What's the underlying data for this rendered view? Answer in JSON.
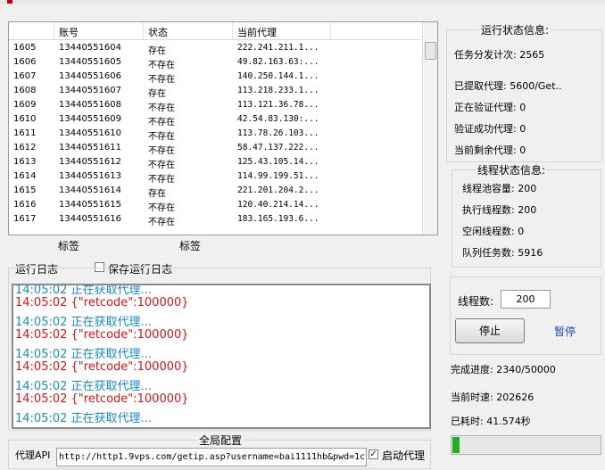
{
  "table": {
    "headers": [
      "",
      "账号",
      "状态",
      "当前代理"
    ],
    "rows": [
      [
        "1605",
        "13440551604",
        "存在",
        "222.241.211.1..."
      ],
      [
        "1606",
        "13440551605",
        "不存在",
        "49.82.163.63:..."
      ],
      [
        "1607",
        "13440551606",
        "不存在",
        "140.250.144.1..."
      ],
      [
        "1608",
        "13440551607",
        "存在",
        "113.218.233.1..."
      ],
      [
        "1609",
        "13440551608",
        "不存在",
        "113.121.36.78..."
      ],
      [
        "1610",
        "13440551609",
        "不存在",
        "42.54.83.130:..."
      ],
      [
        "1611",
        "13440551610",
        "不存在",
        "113.78.26.103..."
      ],
      [
        "1612",
        "13440551611",
        "不存在",
        "58.47.137.222..."
      ],
      [
        "1613",
        "13440551612",
        "不存在",
        "125.43.105.14..."
      ],
      [
        "1614",
        "13440551613",
        "不存在",
        "114.99.199.51..."
      ],
      [
        "1615",
        "13440551614",
        "存在",
        "221.201.204.2..."
      ],
      [
        "1616",
        "13440551615",
        "不存在",
        "120.40.214.14..."
      ],
      [
        "1617",
        "13440551616",
        "不存在",
        "183.165.193.6..."
      ]
    ]
  },
  "labels": {
    "label1": "标签",
    "label2": "标签"
  },
  "log": {
    "title": "运行日志",
    "save_checkbox_label": "保存运行日志",
    "lines": [
      {
        "text": "14:05:02 正在获取代理...",
        "color": "#1a8ad4"
      },
      {
        "text": "14:05:02 {\"retcode\":100000}",
        "color": "#e01414"
      },
      {
        "text": "14:05:02 正在获取代理...",
        "color": "#1a8ad4"
      },
      {
        "text": "14:05:02 {\"retcode\":100000}",
        "color": "#e01414"
      },
      {
        "text": "14:05:02 正在获取代理...",
        "color": "#1a8ad4"
      },
      {
        "text": "14:05:02 {\"retcode\":100000}",
        "color": "#e01414"
      },
      {
        "text": "14:05:02 正在获取代理...",
        "color": "#1a8ad4"
      },
      {
        "text": "14:05:02 {\"retcode\":100000}",
        "color": "#e01414"
      },
      {
        "text": "14:05:02 正在获取代理...",
        "color": "#1a8ad4"
      }
    ]
  },
  "global_config": {
    "title": "全局配置",
    "api_label": "代理API",
    "api_value": "http://http1.9vps.com/getip.asp?username=bai1111hb&pwd=1c",
    "auto_proxy_label": "启动代理",
    "auto_proxy_checked": true
  },
  "run_status": {
    "title": "运行状态信息:",
    "dispatch": "任务分发计次: 2565",
    "extracted": "已提取代理: 5600/Get..",
    "verifying": "正在验证代理: 0",
    "verified": "验证成功代理: 0",
    "remaining": "当前剩余代理: 0"
  },
  "thread_status": {
    "title": "线程状态信息:",
    "pool": "线程池容量: 200",
    "executing": "执行线程数: 200",
    "idle": "空闲线程数: 0",
    "queue": "队列任务数: 5916"
  },
  "controls": {
    "thread_label": "线程数:",
    "thread_value": "200",
    "stop_label": "停止",
    "pause_label": "暂停"
  },
  "stats": {
    "progress_text": "完成进度: 2340/50000",
    "speed_text": "当前时速: 202626",
    "elapsed_text": "已耗时: 41.574秒",
    "progress_fraction": 0.0468,
    "progress_color": "#22b022"
  }
}
